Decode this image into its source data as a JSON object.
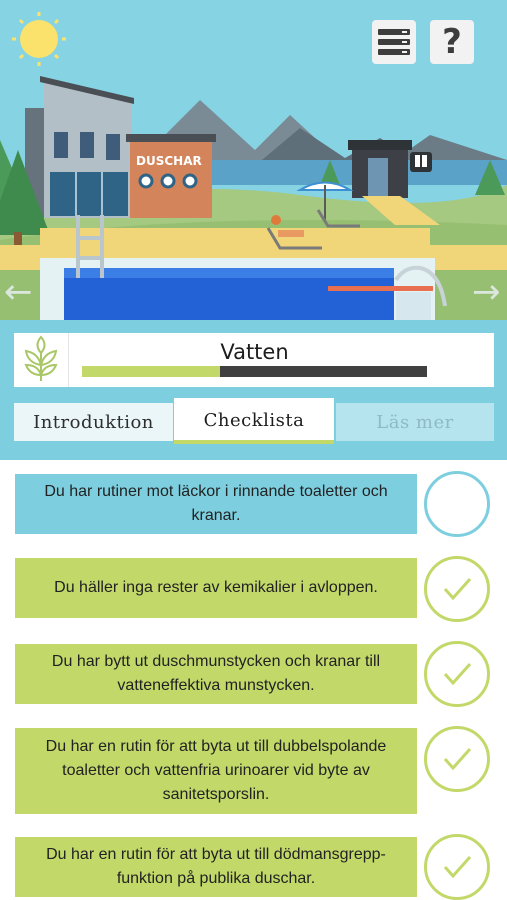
{
  "scene": {
    "building_sign": "DUSCHAR"
  },
  "icons": {
    "menu": "menu-list-icon",
    "help": "help-question-icon",
    "prev": "arrow-left-icon",
    "next": "arrow-right-icon",
    "topic": "leaf-icon",
    "check": "check-icon"
  },
  "help_label": "?",
  "arrows": {
    "prev": "←",
    "next": "→"
  },
  "topic": {
    "title": "Vatten",
    "progress": 0.4
  },
  "tabs": [
    {
      "label": "Introduktion",
      "state": "inactive"
    },
    {
      "label": "Checklista",
      "state": "active"
    },
    {
      "label": "Läs mer",
      "state": "disabled"
    }
  ],
  "checklist": [
    {
      "text": "Du har rutiner mot läckor i rinnande toaletter och kranar.",
      "checked": false
    },
    {
      "text": "Du häller inga rester av kemikalier i avloppen.",
      "checked": true
    },
    {
      "text": "Du har bytt ut duschmunstycken och kranar till vatteneffektiva munstycken.",
      "checked": true
    },
    {
      "text": "Du har en rutin för att byta ut till dubbelspolande toaletter och vattenfria urinoarer vid byte av sanitetsporslin.",
      "checked": true
    },
    {
      "text": "Du har en rutin för att byta ut till dödmansgrepp-funktion på publika duschar.",
      "checked": true
    }
  ],
  "colors": {
    "sky": "#86d3e4",
    "accent_green": "#c2d96a",
    "unchecked_blue": "#7dcfe0",
    "progress_track": "#404040"
  }
}
